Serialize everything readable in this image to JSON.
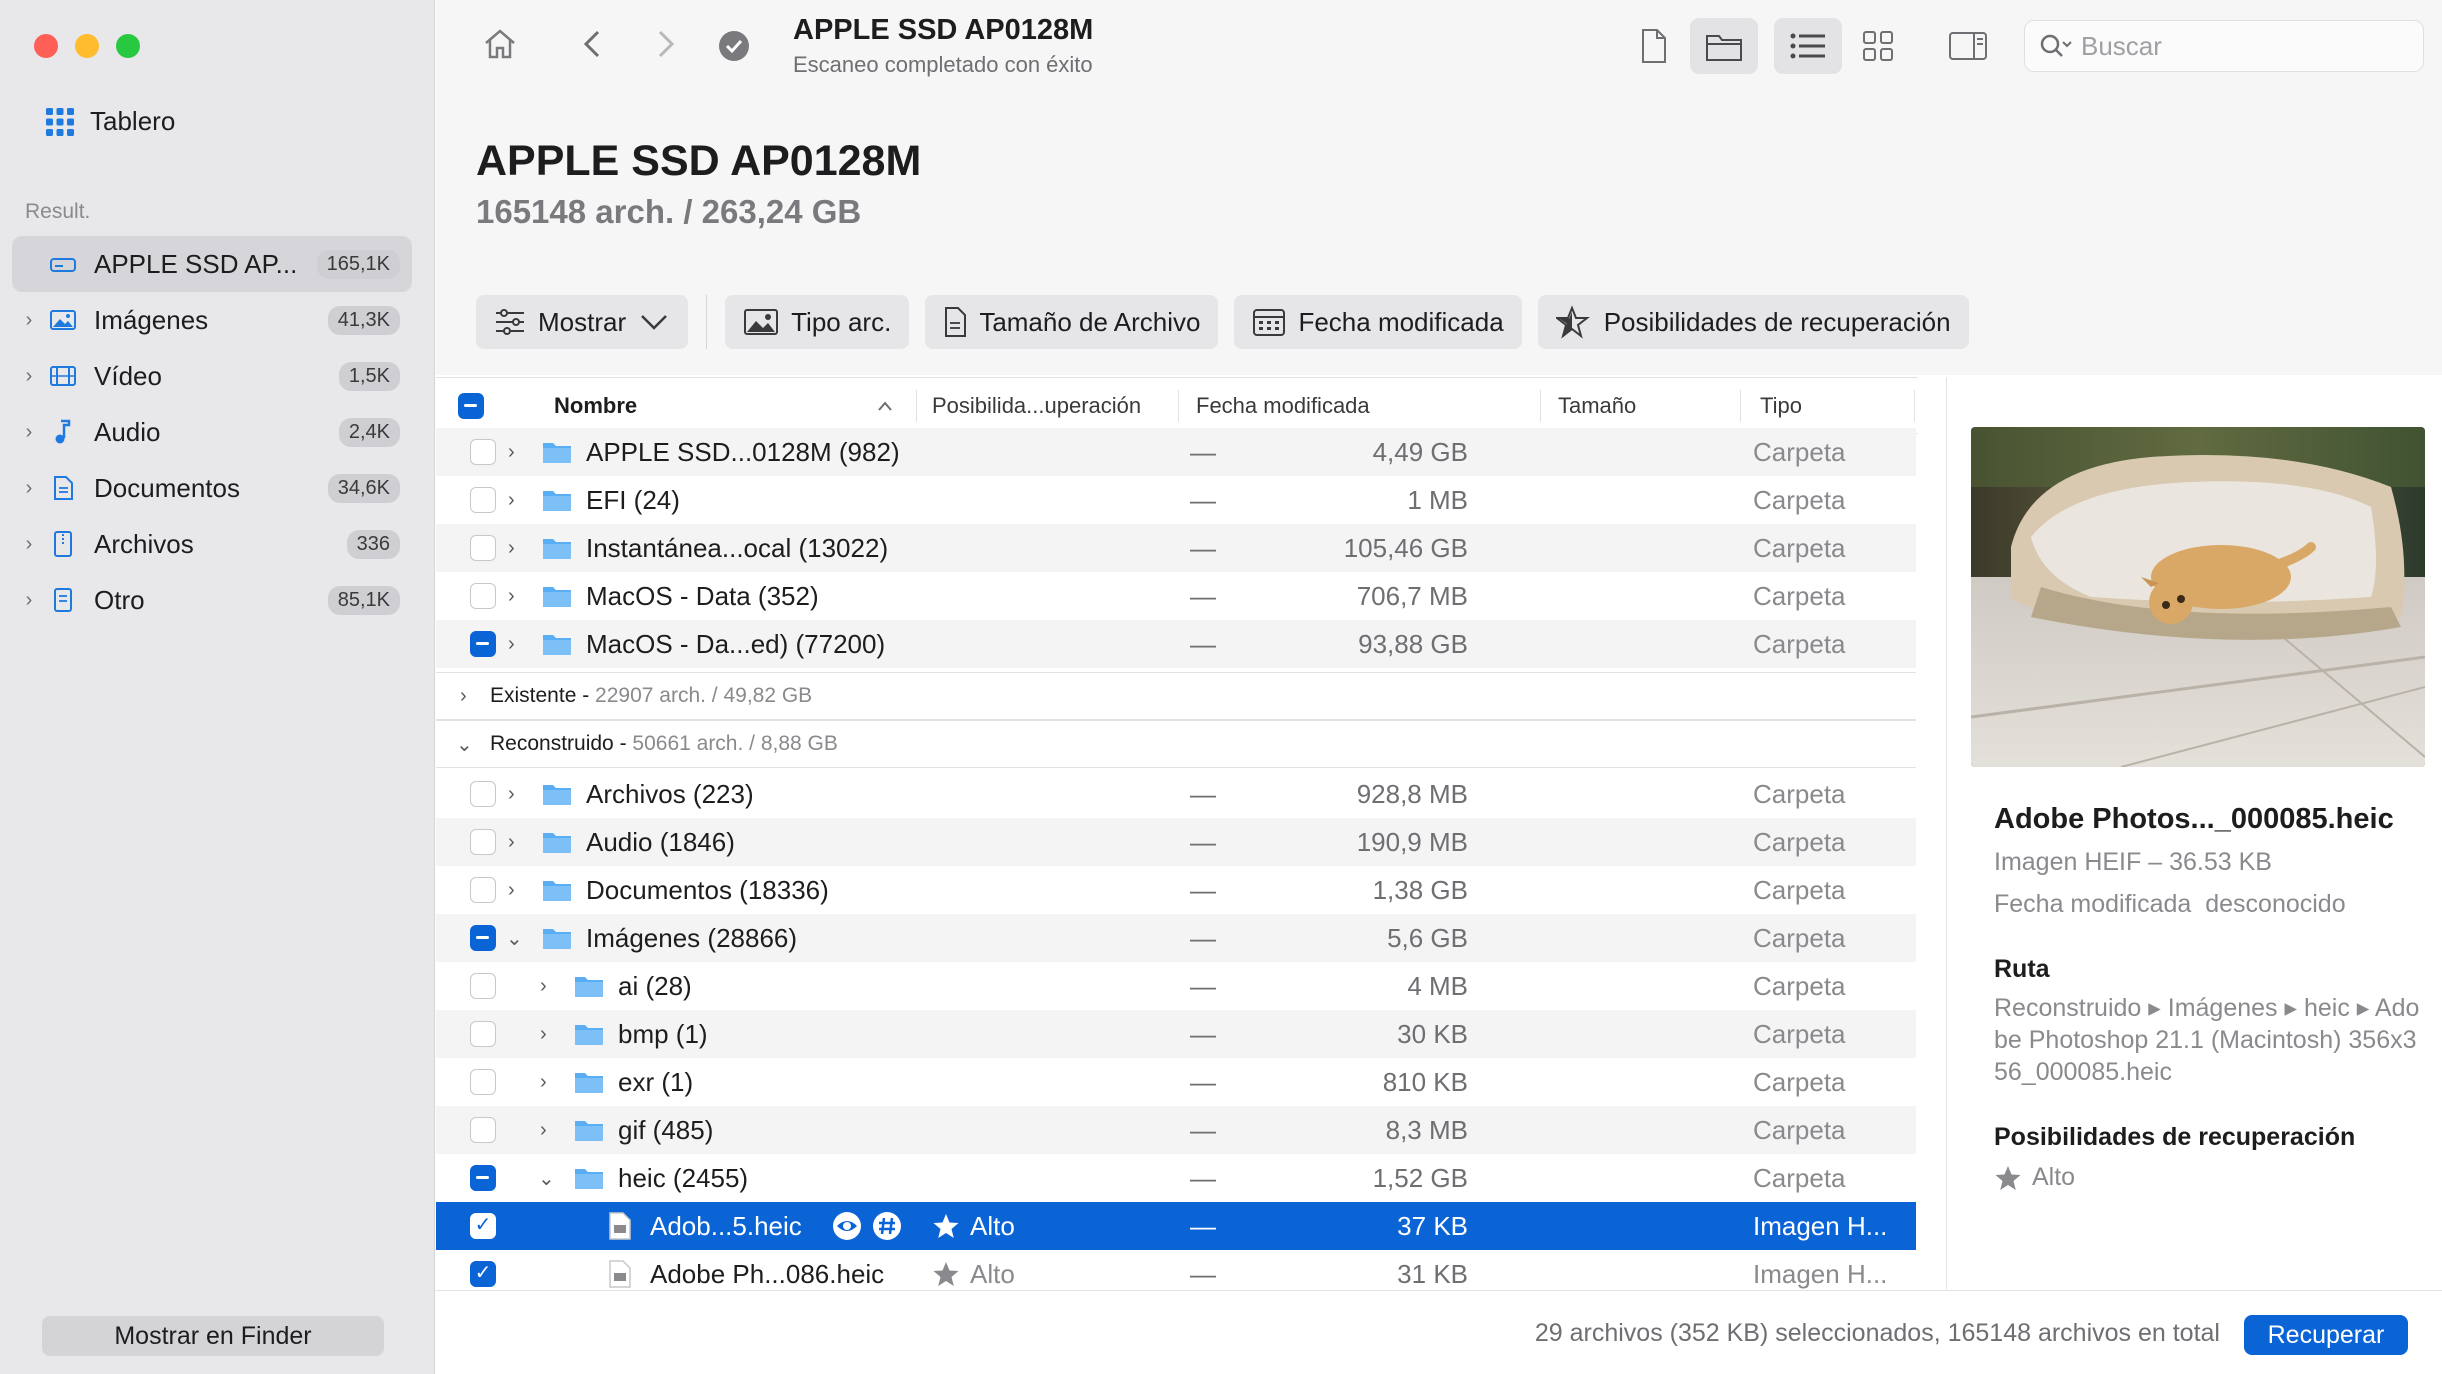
{
  "sidebar": {
    "dashboard_label": "Tablero",
    "section_label": "Result.",
    "items": [
      {
        "label": "APPLE SSD AP...",
        "count": "165,1K"
      },
      {
        "label": "Imágenes",
        "count": "41,3K"
      },
      {
        "label": "Vídeo",
        "count": "1,5K"
      },
      {
        "label": "Audio",
        "count": "2,4K"
      },
      {
        "label": "Documentos",
        "count": "34,6K"
      },
      {
        "label": "Archivos",
        "count": "336"
      },
      {
        "label": "Otro",
        "count": "85,1K"
      }
    ],
    "finder_button": "Mostrar en Finder"
  },
  "toolbar": {
    "title": "APPLE SSD AP0128M",
    "subtitle": "Escaneo completado con éxito",
    "search_placeholder": "Buscar"
  },
  "header": {
    "title": "APPLE SSD AP0128M",
    "summary": "165148 arch. / 263,24 GB"
  },
  "filters": {
    "show": "Mostrar",
    "file_type": "Tipo arc.",
    "file_size": "Tamaño de Archivo",
    "modified_date": "Fecha modificada",
    "recovery_chances": "Posibilidades de recuperación"
  },
  "table": {
    "columns": {
      "name": "Nombre",
      "recovery": "Posibilida...uperación",
      "modified": "Fecha modificada",
      "size": "Tamaño",
      "type": "Tipo"
    },
    "top_rows": [
      {
        "name": "APPLE SSD...0128M (982)",
        "date": "—",
        "size": "4,49 GB",
        "type": "Carpeta"
      },
      {
        "name": "EFI (24)",
        "date": "—",
        "size": "1 MB",
        "type": "Carpeta"
      },
      {
        "name": "Instantánea...ocal (13022)",
        "date": "—",
        "size": "105,46 GB",
        "type": "Carpeta"
      },
      {
        "name": "MacOS - Data (352)",
        "date": "—",
        "size": "706,7 MB",
        "type": "Carpeta"
      },
      {
        "name": "MacOS - Da...ed) (77200)",
        "date": "—",
        "size": "93,88 GB",
        "type": "Carpeta"
      }
    ],
    "group_existing": {
      "name": "Existente - ",
      "info": "22907 arch. / 49,82 GB"
    },
    "group_rebuilt": {
      "name": "Reconstruido - ",
      "info": "50661 arch. / 8,88 GB"
    },
    "rebuilt_rows": [
      {
        "name": "Archivos (223)",
        "date": "—",
        "size": "928,8 MB",
        "type": "Carpeta"
      },
      {
        "name": "Audio (1846)",
        "date": "—",
        "size": "190,9 MB",
        "type": "Carpeta"
      },
      {
        "name": "Documentos (18336)",
        "date": "—",
        "size": "1,38 GB",
        "type": "Carpeta"
      },
      {
        "name": "Imágenes (28866)",
        "date": "—",
        "size": "5,6 GB",
        "type": "Carpeta"
      },
      {
        "name": "ai (28)",
        "date": "—",
        "size": "4 MB",
        "type": "Carpeta"
      },
      {
        "name": "bmp (1)",
        "date": "—",
        "size": "30 KB",
        "type": "Carpeta"
      },
      {
        "name": "exr (1)",
        "date": "—",
        "size": "810 KB",
        "type": "Carpeta"
      },
      {
        "name": "gif (485)",
        "date": "—",
        "size": "8,3 MB",
        "type": "Carpeta"
      },
      {
        "name": "heic (2455)",
        "date": "—",
        "size": "1,52 GB",
        "type": "Carpeta"
      },
      {
        "name": "Adob...5.heic",
        "recovery": "Alto",
        "date": "—",
        "size": "37 KB",
        "type": "Imagen H..."
      },
      {
        "name": "Adobe Ph...086.heic",
        "recovery": "Alto",
        "date": "—",
        "size": "31 KB",
        "type": "Imagen H..."
      }
    ]
  },
  "preview": {
    "file_name": "Adobe Photos..._000085.heic",
    "file_kind": "Imagen HEIF – 36.53 KB",
    "modified_label": "Fecha modificada",
    "modified_value": "desconocido",
    "path_heading": "Ruta",
    "path_value": "Reconstruido ▸ Imágenes ▸ heic ▸ Adobe Photoshop 21.1 (Macintosh) 356x356_000085.heic",
    "recovery_heading": "Posibilidades de recuperación",
    "recovery_value": "Alto"
  },
  "bottom": {
    "status": "29 archivos (352 KB) seleccionados, 165148 archivos en total",
    "recover_button": "Recuperar"
  },
  "colors": {
    "accent": "#0a64d6",
    "sidebar_bg": "#e8e8ea",
    "folder": "#5aaef4"
  }
}
